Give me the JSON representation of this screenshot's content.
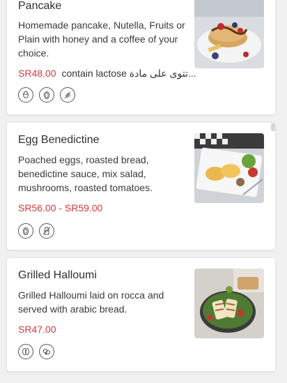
{
  "items": [
    {
      "title": "Pancake",
      "description": "Homemade pancake, Nutella, Fruits or Plain with honey and a coffee of your choice.",
      "price": "SR48.00",
      "note": "contain lactose تتوى على مادة...",
      "icons": [
        "nut-icon",
        "egg-icon",
        "wheat-icon"
      ]
    },
    {
      "title": "Egg Benedictine",
      "description": "Poached eggs, roasted bread, benedictine sauce, mix salad, mushrooms, roasted tomatoes.",
      "price": "SR56.00 - SR59.00",
      "icons": [
        "egg-icon",
        "milk-icon"
      ]
    },
    {
      "title": "Grilled Halloumi",
      "description": "Grilled Halloumi laid on rocca and served with arabic bread.",
      "price": "SR47.00",
      "icons": [
        "soy-icon",
        "mixed-allergen-icon"
      ]
    }
  ]
}
